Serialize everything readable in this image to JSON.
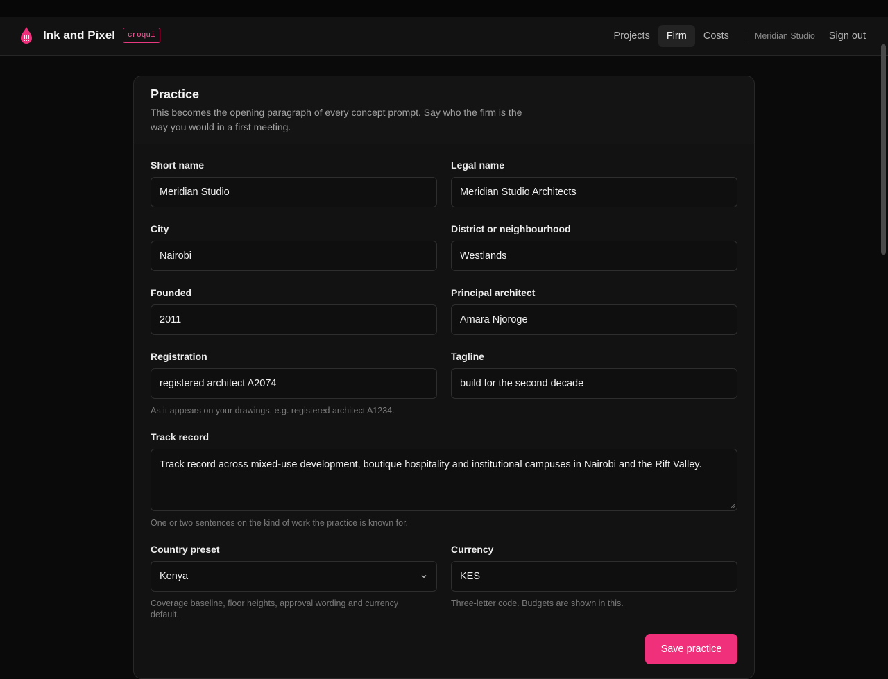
{
  "app": {
    "brand_name": "Ink and Pixel",
    "badge": "croqui",
    "accent": "#f0307b"
  },
  "nav": {
    "items": [
      {
        "label": "Projects",
        "active": false
      },
      {
        "label": "Firm",
        "active": true
      },
      {
        "label": "Costs",
        "active": false
      }
    ],
    "org_name": "Meridian Studio",
    "sign_out": "Sign out"
  },
  "practice": {
    "title": "Practice",
    "description": "This becomes the opening paragraph of every concept prompt. Say who the firm is the way you would in a first meeting.",
    "short_name": {
      "label": "Short name",
      "value": "Meridian Studio"
    },
    "legal_name": {
      "label": "Legal name",
      "value": "Meridian Studio Architects"
    },
    "city": {
      "label": "City",
      "value": "Nairobi"
    },
    "district": {
      "label": "District or neighbourhood",
      "value": "Westlands"
    },
    "founded": {
      "label": "Founded",
      "value": "2011"
    },
    "principal": {
      "label": "Principal architect",
      "value": "Amara Njoroge"
    },
    "registration": {
      "label": "Registration",
      "value": "registered architect A2074",
      "hint": "As it appears on your drawings, e.g. registered architect A1234."
    },
    "tagline": {
      "label": "Tagline",
      "value": "build for the second decade"
    },
    "track_record": {
      "label": "Track record",
      "value": "Track record across mixed-use development, boutique hospitality and institutional campuses in Nairobi and the Rift Valley.",
      "hint": "One or two sentences on the kind of work the practice is known for."
    },
    "country_preset": {
      "label": "Country preset",
      "value": "Kenya",
      "hint": "Coverage baseline, floor heights, approval wording and currency default."
    },
    "currency": {
      "label": "Currency",
      "value": "KES",
      "hint": "Three-letter code. Budgets are shown in this."
    },
    "save_label": "Save practice"
  }
}
